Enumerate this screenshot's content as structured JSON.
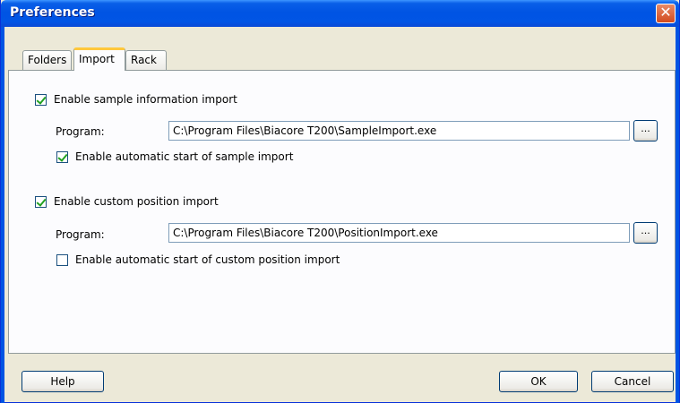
{
  "window": {
    "title": "Preferences",
    "close_symbol": "✕"
  },
  "tabs": [
    {
      "label": "Folders"
    },
    {
      "label": "Import"
    },
    {
      "label": "Rack"
    }
  ],
  "sample_import": {
    "enable_label": "Enable sample information import",
    "enabled": true,
    "program_label": "Program:",
    "program_value": "C:\\Program Files\\Biacore T200\\SampleImport.exe",
    "browse_label": "...",
    "auto_start_label": "Enable automatic start of sample import",
    "auto_start": true
  },
  "position_import": {
    "enable_label": "Enable custom position import",
    "enabled": true,
    "program_label": "Program:",
    "program_value": "C:\\Program Files\\Biacore T200\\PositionImport.exe",
    "browse_label": "...",
    "auto_start_label": "Enable automatic start of custom position import",
    "auto_start": false
  },
  "buttons": {
    "help": "Help",
    "ok": "OK",
    "cancel": "Cancel"
  },
  "colors": {
    "titlebar": "#0054e3",
    "dialog_bg": "#ece9d8",
    "check": "#21a121",
    "active_tab_accent": "#ffc83c"
  }
}
